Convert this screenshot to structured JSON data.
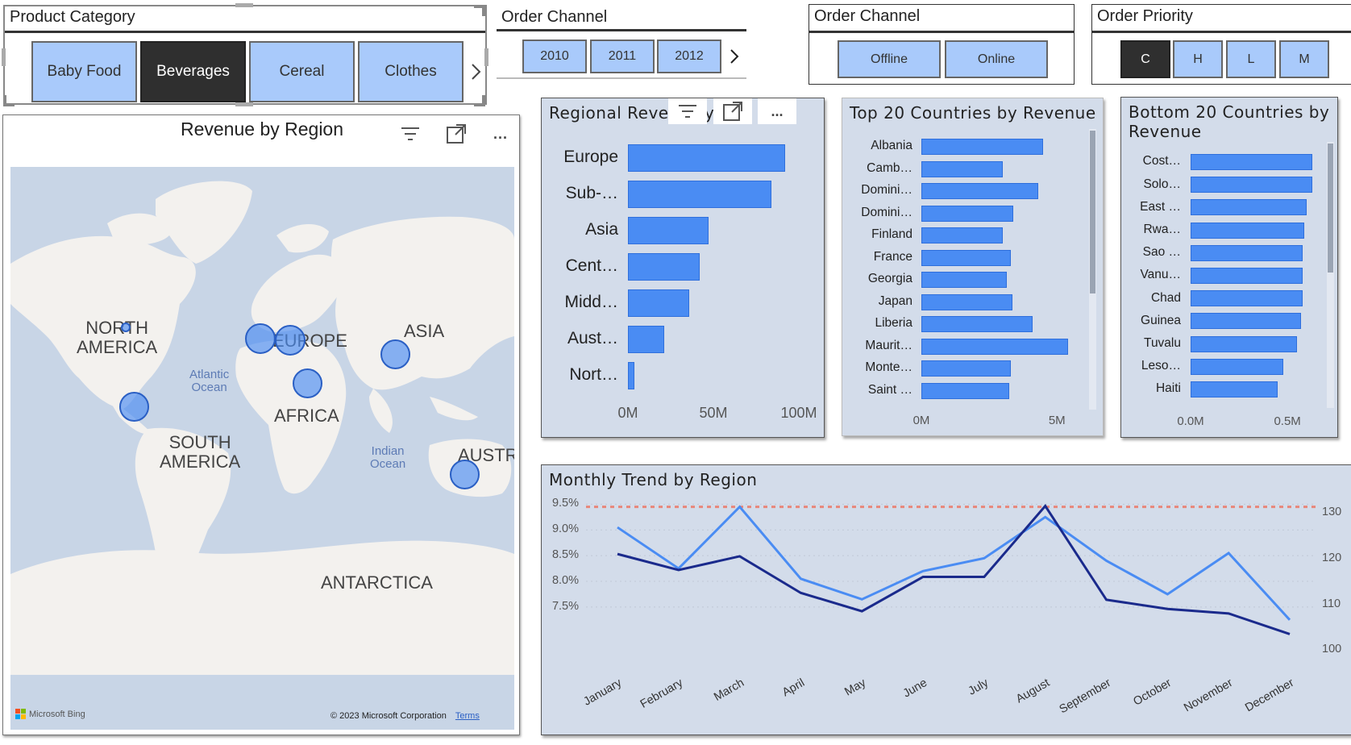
{
  "slicers": {
    "product_category": {
      "title": "Product Category",
      "items": [
        {
          "label": "Baby Food",
          "selected": false
        },
        {
          "label": "Beverages",
          "selected": true
        },
        {
          "label": "Cereal",
          "selected": false
        },
        {
          "label": "Clothes",
          "selected": false
        }
      ],
      "next_icon": "chevron-right-icon"
    },
    "order_channel_year": {
      "title": "Order Channel",
      "items": [
        {
          "label": "2010",
          "selected": false
        },
        {
          "label": "2011",
          "selected": false
        },
        {
          "label": "2012",
          "selected": false
        }
      ],
      "next_icon": "chevron-right-icon"
    },
    "order_channel": {
      "title": "Order Channel",
      "items": [
        {
          "label": "Offline",
          "selected": false
        },
        {
          "label": "Online",
          "selected": false
        }
      ]
    },
    "order_priority": {
      "title": "Order Priority",
      "items": [
        {
          "label": "C",
          "selected": true
        },
        {
          "label": "H",
          "selected": false
        },
        {
          "label": "L",
          "selected": false
        },
        {
          "label": "M",
          "selected": false
        }
      ]
    }
  },
  "map": {
    "title": "Revenue by Region",
    "continents": [
      {
        "label": "NORTH\nAMERICA"
      },
      {
        "label": "EUROPE"
      },
      {
        "label": "ASIA"
      },
      {
        "label": "AFRICA"
      },
      {
        "label": "SOUTH\nAMERICA"
      },
      {
        "label": "AUSTRA"
      },
      {
        "label": "ANTARCTICA"
      }
    ],
    "oceans": [
      {
        "label": "Atlantic\nOcean"
      },
      {
        "label": "Indian\nOcean"
      }
    ],
    "attribution": "© 2023 Microsoft Corporation",
    "terms": "Terms",
    "bing_logo": "Microsoft Bing"
  },
  "toolbar": {
    "filter_icon": "filter-icon",
    "focus_icon": "focus-mode-icon",
    "more_icon": "more-options-icon",
    "more_label": "..."
  },
  "charts": {
    "regional": {
      "title": "Regional Revenue by Region",
      "visible_title": "Regional Rever",
      "visible_title_tail": "y"
    },
    "top20": {
      "title": "Top 20 Countries by Revenue"
    },
    "bottom20": {
      "title_line1": "Bottom 20 Countries by",
      "title_line2": "Revenue"
    },
    "monthly": {
      "title": "Monthly Trend by Region"
    }
  },
  "colors": {
    "bar": "#4a8cf3",
    "line_light": "#4a8cf3",
    "line_dark": "#1a2a8c",
    "reference_line": "#e8867a",
    "panel_bg": "#d3dcea",
    "map_water": "#c8d5e6",
    "map_land": "#f3f1ee"
  },
  "chart_data": [
    {
      "type": "bar",
      "orientation": "horizontal",
      "title": "Regional Revenue by Region",
      "categories": [
        "Europe",
        "Sub-…",
        "Asia",
        "Cent…",
        "Midd…",
        "Aust…",
        "Nort…"
      ],
      "values": [
        92,
        84,
        47,
        42,
        36,
        21,
        4
      ],
      "unit": "M",
      "xticks": [
        "0M",
        "50M",
        "100M"
      ],
      "xlim": [
        0,
        100
      ]
    },
    {
      "type": "bar",
      "orientation": "horizontal",
      "title": "Top 20 Countries by Revenue",
      "categories": [
        "Albania",
        "Camb…",
        "Domini…",
        "Domini…",
        "Finland",
        "France",
        "Georgia",
        "Japan",
        "Liberia",
        "Maurit…",
        "Monte…",
        "Saint …"
      ],
      "values": [
        4.5,
        3.0,
        4.3,
        3.4,
        3.0,
        3.3,
        3.15,
        3.35,
        4.1,
        5.4,
        3.3,
        3.25
      ],
      "unit": "M",
      "xticks": [
        "0M",
        "5M"
      ],
      "xlim": [
        0,
        6.3
      ]
    },
    {
      "type": "bar",
      "orientation": "horizontal",
      "title": "Bottom 20 Countries by Revenue",
      "categories": [
        "Cost…",
        "Solo…",
        "East …",
        "Rwa…",
        "Sao …",
        "Vanu…",
        "Chad",
        "Guinea",
        "Tuvalu",
        "Leso…",
        "Haiti"
      ],
      "values": [
        0.63,
        0.63,
        0.6,
        0.585,
        0.58,
        0.58,
        0.58,
        0.57,
        0.55,
        0.48,
        0.45
      ],
      "unit": "M",
      "xticks": [
        "0.0M",
        "0.5M"
      ],
      "xlim": [
        0,
        0.72
      ]
    },
    {
      "type": "line",
      "title": "Monthly Trend by Region",
      "x": [
        "January",
        "February",
        "March",
        "April",
        "May",
        "June",
        "July",
        "August",
        "September",
        "October",
        "November",
        "December"
      ],
      "series": [
        {
          "axis": "left",
          "values": [
            9.05,
            8.25,
            9.45,
            8.05,
            7.65,
            8.2,
            8.45,
            9.25,
            8.4,
            7.75,
            8.55,
            7.25
          ]
        },
        {
          "axis": "right",
          "values": [
            121,
            117.5,
            120.5,
            112.5,
            108.5,
            116,
            116,
            131.5,
            111,
            109,
            108,
            103.5
          ]
        }
      ],
      "reference_line": {
        "axis": "left",
        "value": 9.45
      },
      "y_left": {
        "ticks": [
          "7.5%",
          "8.0%",
          "8.5%",
          "9.0%",
          "9.5%"
        ],
        "lim": [
          7.2,
          9.6
        ]
      },
      "y_right": {
        "ticks": [
          "100",
          "110",
          "120",
          "130"
        ],
        "lim": [
          99,
          133
        ]
      }
    }
  ]
}
